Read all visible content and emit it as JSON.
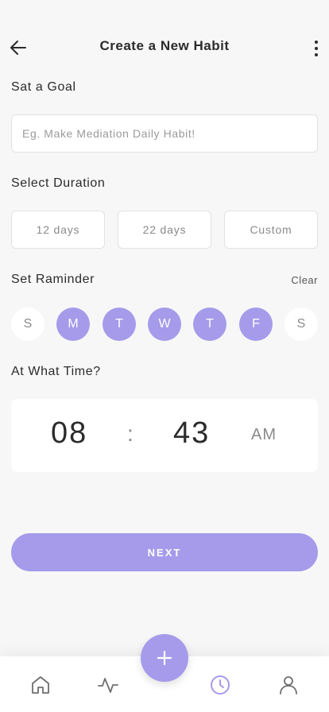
{
  "header": {
    "title": "Create a New Habit",
    "back_icon": "arrow-left-icon",
    "more_icon": "more-vertical-icon"
  },
  "goal": {
    "label": "Sat a Goal",
    "placeholder": "Eg. Make Mediation Daily Habit!",
    "value": ""
  },
  "duration": {
    "label": "Select Duration",
    "options": [
      "12 days",
      "22 days",
      "Custom"
    ]
  },
  "reminder": {
    "label": "Set Raminder",
    "clear_label": "Clear",
    "days": [
      {
        "label": "S",
        "selected": false
      },
      {
        "label": "M",
        "selected": true
      },
      {
        "label": "T",
        "selected": true
      },
      {
        "label": "W",
        "selected": true
      },
      {
        "label": "T",
        "selected": true
      },
      {
        "label": "F",
        "selected": true
      },
      {
        "label": "S",
        "selected": false
      }
    ]
  },
  "time": {
    "label": "At What Time?",
    "hour": "08",
    "separator": ":",
    "minute": "43",
    "ampm": "AM"
  },
  "next_button": {
    "label": "NEXT"
  },
  "bottom_nav": {
    "items": [
      {
        "icon": "home-icon",
        "active": false
      },
      {
        "icon": "activity-icon",
        "active": false
      },
      {
        "icon": "clock-icon",
        "active": true
      },
      {
        "icon": "user-icon",
        "active": false
      }
    ],
    "fab_icon": "plus-icon"
  },
  "colors": {
    "accent": "#a59bea",
    "background": "#f7f7f7",
    "text": "#2b2b2b",
    "muted": "#8a8a8a"
  }
}
